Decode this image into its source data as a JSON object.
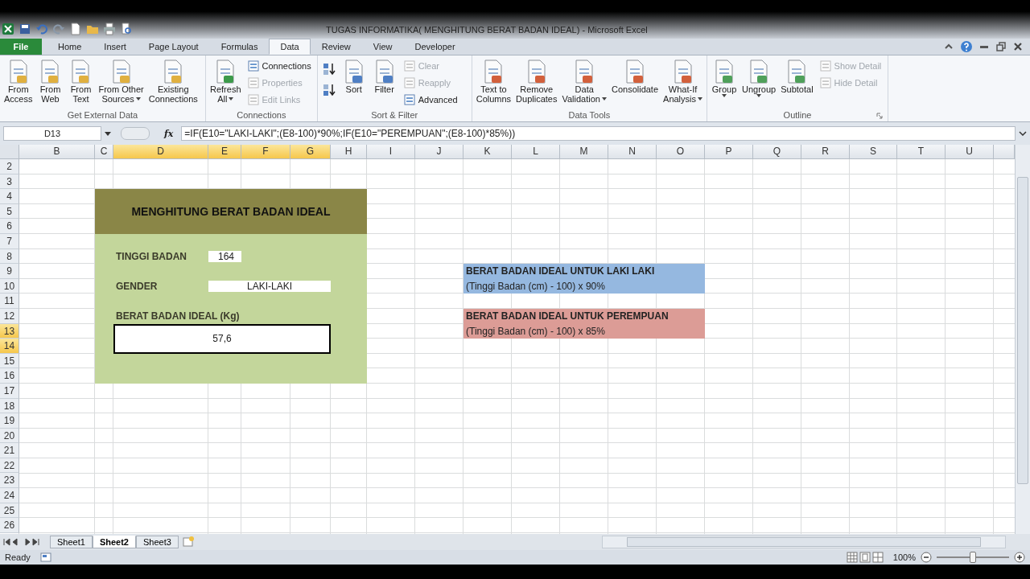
{
  "window": {
    "title": "TUGAS INFORMATIKA( MENGHITUNG BERAT BADAN IDEAL)  -  Microsoft Excel"
  },
  "ribbon": {
    "file_tab": "File",
    "tabs": [
      {
        "label": "Home",
        "selected": false
      },
      {
        "label": "Insert",
        "selected": false
      },
      {
        "label": "Page Layout",
        "selected": false
      },
      {
        "label": "Formulas",
        "selected": false
      },
      {
        "label": "Data",
        "selected": true
      },
      {
        "label": "Review",
        "selected": false
      },
      {
        "label": "View",
        "selected": false
      },
      {
        "label": "Developer",
        "selected": false
      }
    ],
    "groups": [
      {
        "label": "Get External Data",
        "items": [
          {
            "kind": "large",
            "lines": [
              "From",
              "Access"
            ],
            "dropdown": false
          },
          {
            "kind": "large",
            "lines": [
              "From",
              "Web"
            ],
            "dropdown": false
          },
          {
            "kind": "large",
            "lines": [
              "From",
              "Text"
            ],
            "dropdown": false
          },
          {
            "kind": "large",
            "lines": [
              "From Other",
              "Sources"
            ],
            "dropdown": true
          },
          {
            "kind": "large",
            "lines": [
              "Existing",
              "Connections"
            ],
            "dropdown": false
          }
        ]
      },
      {
        "label": "Connections",
        "items": [
          {
            "kind": "large",
            "lines": [
              "Refresh",
              "All"
            ],
            "dropdown": true
          },
          {
            "kind": "stack",
            "buttons": [
              {
                "label": "Connections",
                "disabled": false
              },
              {
                "label": "Properties",
                "disabled": true
              },
              {
                "label": "Edit Links",
                "disabled": true
              }
            ]
          }
        ]
      },
      {
        "label": "Sort & Filter",
        "items": [
          {
            "kind": "sort-icons"
          },
          {
            "kind": "large",
            "lines": [
              "Sort"
            ],
            "dropdown": false
          },
          {
            "kind": "large",
            "lines": [
              "Filter"
            ],
            "dropdown": false
          },
          {
            "kind": "stack",
            "buttons": [
              {
                "label": "Clear",
                "disabled": true
              },
              {
                "label": "Reapply",
                "disabled": true
              },
              {
                "label": "Advanced",
                "disabled": false
              }
            ]
          }
        ]
      },
      {
        "label": "Data Tools",
        "items": [
          {
            "kind": "large",
            "lines": [
              "Text to",
              "Columns"
            ],
            "dropdown": false
          },
          {
            "kind": "large",
            "lines": [
              "Remove",
              "Duplicates"
            ],
            "dropdown": false
          },
          {
            "kind": "large",
            "lines": [
              "Data",
              "Validation"
            ],
            "dropdown": true
          },
          {
            "kind": "large",
            "lines": [
              "Consolidate"
            ],
            "dropdown": false
          },
          {
            "kind": "large",
            "lines": [
              "What-If",
              "Analysis"
            ],
            "dropdown": true
          }
        ]
      },
      {
        "label": "Outline",
        "items": [
          {
            "kind": "large",
            "lines": [
              "Group"
            ],
            "dropdown": true
          },
          {
            "kind": "large",
            "lines": [
              "Ungroup"
            ],
            "dropdown": true
          },
          {
            "kind": "large",
            "lines": [
              "Subtotal"
            ],
            "dropdown": false
          },
          {
            "kind": "stack",
            "buttons": [
              {
                "label": "Show Detail",
                "disabled": true
              },
              {
                "label": "Hide Detail",
                "disabled": true
              }
            ]
          }
        ]
      }
    ]
  },
  "formula_bar": {
    "name_box": "D13",
    "function_symbol": "fx",
    "formula": "=IF(E10=\"LAKI-LAKI\";(E8-100)*90%;IF(E10=\"PEREMPUAN\";(E8-100)*85%))"
  },
  "sheet": {
    "columns": [
      {
        "label": "B",
        "selected": false
      },
      {
        "label": "C",
        "selected": false
      },
      {
        "label": "D",
        "selected": true
      },
      {
        "label": "E",
        "selected": true
      },
      {
        "label": "F",
        "selected": true
      },
      {
        "label": "G",
        "selected": true
      },
      {
        "label": "H",
        "selected": false
      },
      {
        "label": "I",
        "selected": false
      },
      {
        "label": "J",
        "selected": false
      },
      {
        "label": "K",
        "selected": false
      },
      {
        "label": "L",
        "selected": false
      },
      {
        "label": "M",
        "selected": false
      },
      {
        "label": "N",
        "selected": false
      },
      {
        "label": "O",
        "selected": false
      },
      {
        "label": "P",
        "selected": false
      },
      {
        "label": "Q",
        "selected": false
      },
      {
        "label": "R",
        "selected": false
      },
      {
        "label": "S",
        "selected": false
      },
      {
        "label": "T",
        "selected": false
      },
      {
        "label": "U",
        "selected": false
      }
    ],
    "rows": [
      {
        "label": "2",
        "selected": false
      },
      {
        "label": "3",
        "selected": false
      },
      {
        "label": "4",
        "selected": false
      },
      {
        "label": "5",
        "selected": false
      },
      {
        "label": "6",
        "selected": false
      },
      {
        "label": "7",
        "selected": false
      },
      {
        "label": "8",
        "selected": false
      },
      {
        "label": "9",
        "selected": false
      },
      {
        "label": "10",
        "selected": false
      },
      {
        "label": "11",
        "selected": false
      },
      {
        "label": "12",
        "selected": false
      },
      {
        "label": "13",
        "selected": true
      },
      {
        "label": "14",
        "selected": true
      },
      {
        "label": "15",
        "selected": false
      },
      {
        "label": "16",
        "selected": false
      },
      {
        "label": "17",
        "selected": false
      },
      {
        "label": "18",
        "selected": false
      },
      {
        "label": "19",
        "selected": false
      },
      {
        "label": "20",
        "selected": false
      },
      {
        "label": "21",
        "selected": false
      },
      {
        "label": "22",
        "selected": false
      },
      {
        "label": "23",
        "selected": false
      },
      {
        "label": "24",
        "selected": false
      },
      {
        "label": "25",
        "selected": false
      },
      {
        "label": "26",
        "selected": false
      }
    ],
    "title": "MENGHITUNG BERAT BADAN IDEAL",
    "fields": [
      {
        "label": "TINGGI BADAN",
        "value": "164"
      },
      {
        "label": "GENDER",
        "value": "LAKI-LAKI"
      }
    ],
    "result": {
      "label": "BERAT BADAN IDEAL (Kg)",
      "value": "57,6"
    },
    "notes": [
      {
        "title": "BERAT BADAN IDEAL UNTUK LAKI LAKI",
        "formula": "(Tinggi Badan (cm) - 100) x 90%",
        "color": "#95b8e0"
      },
      {
        "title": "BERAT BADAN IDEAL UNTUK PEREMPUAN",
        "formula": "(Tinggi Badan (cm) - 100) x 85%",
        "color": "#dc9c96"
      }
    ]
  },
  "sheet_tabs": [
    {
      "label": "Sheet1",
      "selected": false
    },
    {
      "label": "Sheet2",
      "selected": true
    },
    {
      "label": "Sheet3",
      "selected": false
    }
  ],
  "status_bar": {
    "status": "Ready",
    "zoom": "100%",
    "zoom_slider": {
      "level": 0.5
    }
  }
}
